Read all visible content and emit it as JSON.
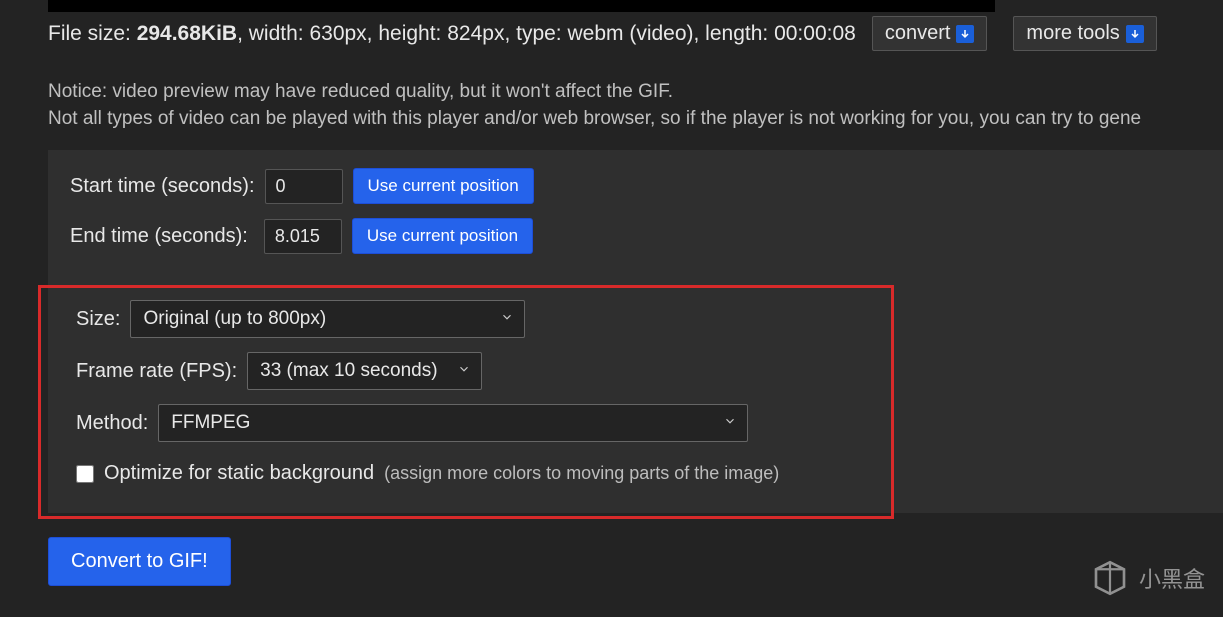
{
  "file_info": {
    "prefix": "File size: ",
    "size": "294.68KiB",
    "rest": ", width: 630px, height: 824px, type: webm (video), length: 00:00:08"
  },
  "buttons": {
    "convert": "convert",
    "more_tools": "more tools",
    "use_current_position": "Use current position",
    "convert_to_gif": "Convert to GIF!"
  },
  "notice": {
    "line1": "Notice: video preview may have reduced quality, but it won't affect the GIF.",
    "line2": "Not all types of video can be played with this player and/or web browser, so if the player is not working for you, you can try to gene"
  },
  "time": {
    "start_label": "Start time (seconds):",
    "start_value": "0",
    "end_label": "End time (seconds):",
    "end_value": "8.015"
  },
  "options": {
    "size_label": "Size:",
    "size_value": "Original (up to 800px)",
    "fps_label": "Frame rate (FPS):",
    "fps_value": "33 (max 10 seconds)",
    "method_label": "Method:",
    "method_value": "FFMPEG",
    "optimize_label": "Optimize for static background",
    "optimize_hint": "(assign more colors to moving parts of the image)"
  },
  "watermark": "小黑盒"
}
